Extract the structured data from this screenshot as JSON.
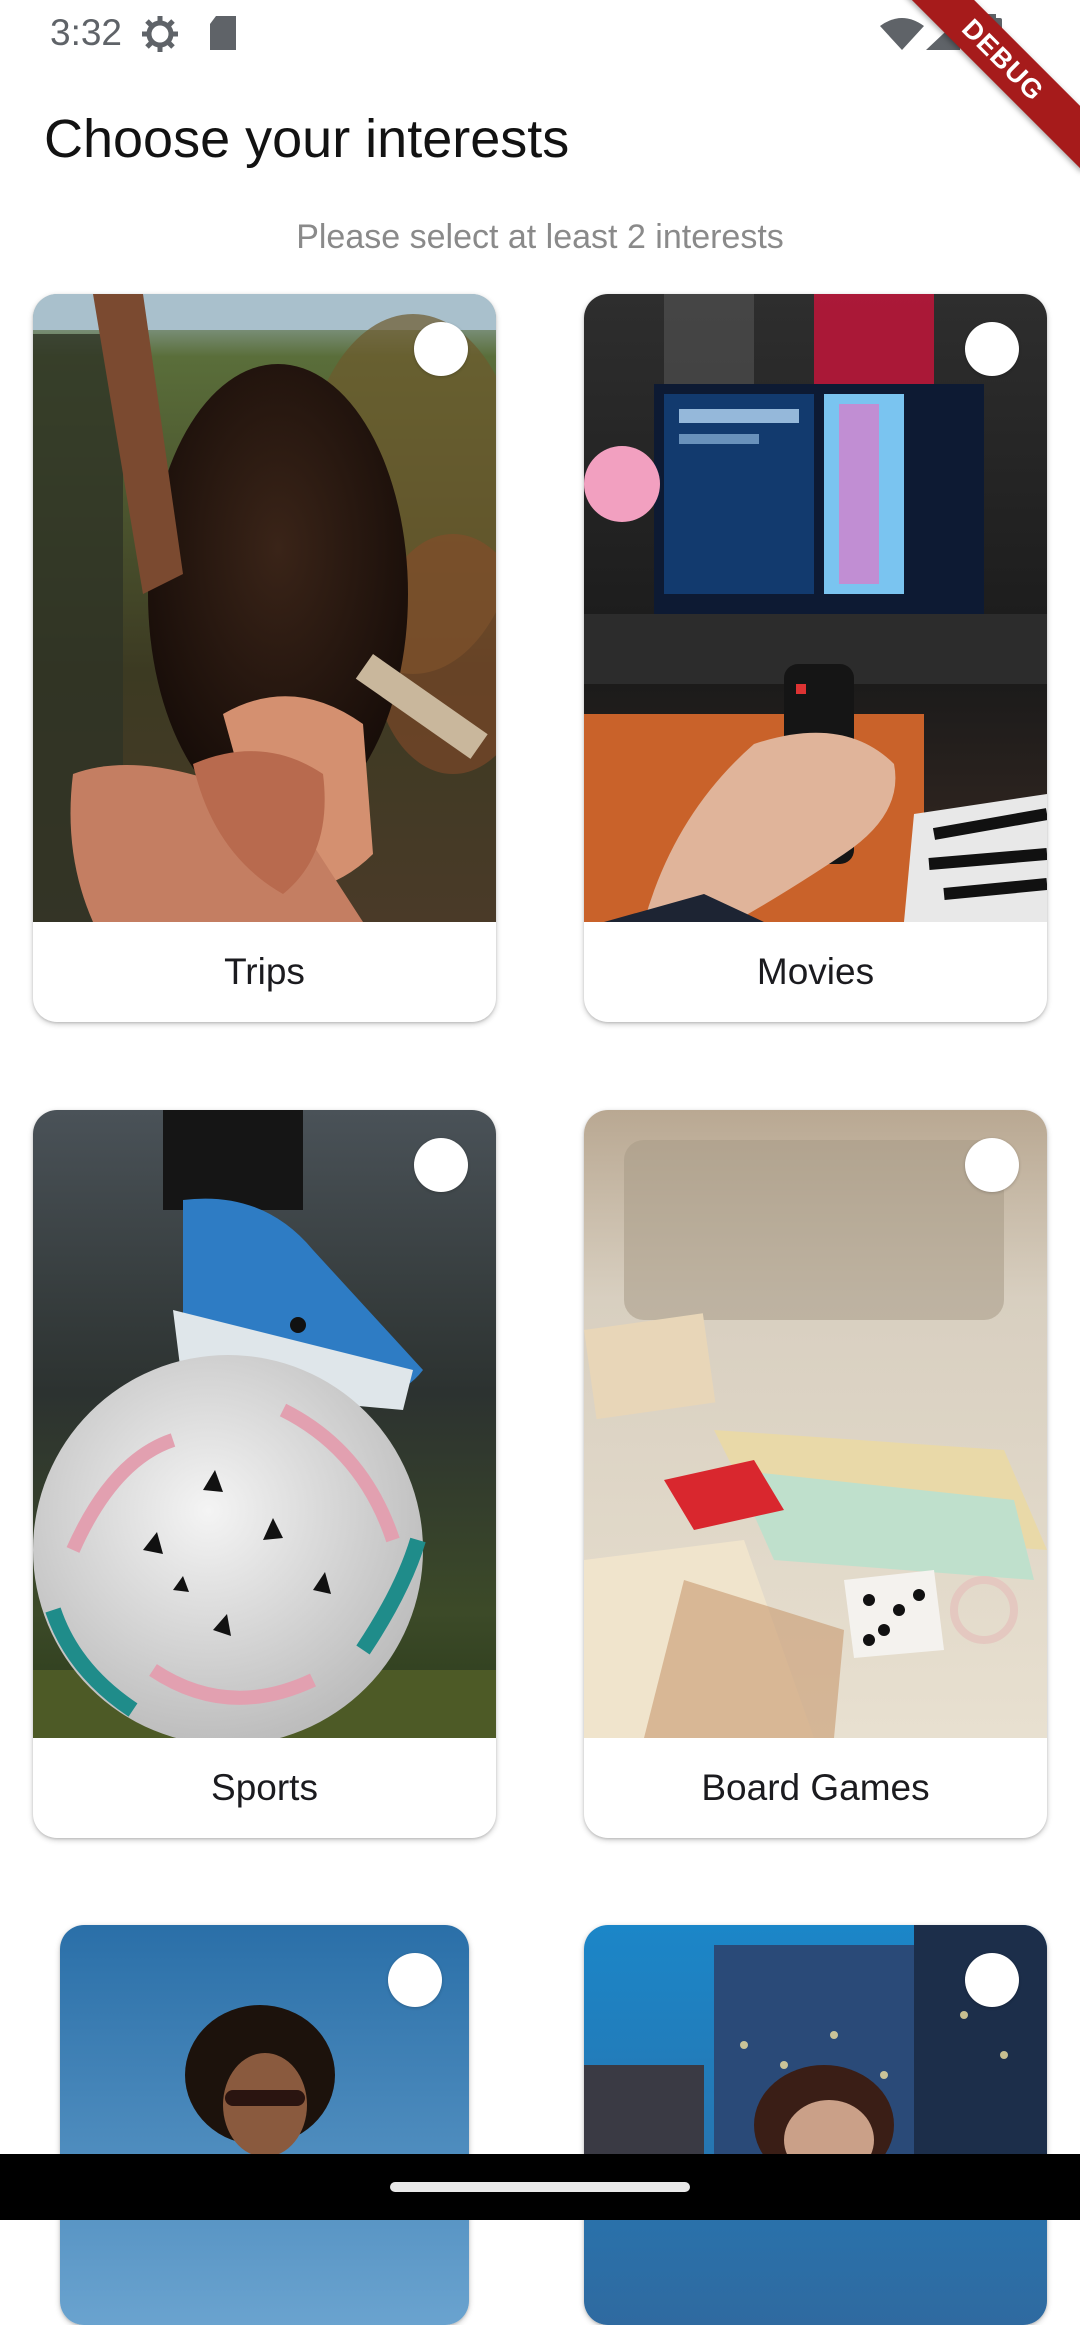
{
  "status_bar": {
    "time": "3:32",
    "icons": [
      "settings-icon",
      "sd-card-icon",
      "wifi-icon",
      "cellular-signal-icon",
      "battery-icon"
    ],
    "debug_banner": "DEBUG",
    "debug_color": "#a61b1b"
  },
  "header": {
    "title": "Choose your interests",
    "subtitle": "Please select at least 2 interests"
  },
  "interests": [
    {
      "label": "Trips",
      "image": "hands-holding-outdoors-photo",
      "selected": false
    },
    {
      "label": "Movies",
      "image": "tv-remote-photo",
      "selected": false
    },
    {
      "label": "Sports",
      "image": "soccer-ball-cleat-photo",
      "selected": false
    },
    {
      "label": "Board Games",
      "image": "monopoly-board-dice-photo",
      "selected": false
    },
    {
      "label": "",
      "image": "woman-sunglasses-blue-sky-photo",
      "selected": false
    },
    {
      "label": "",
      "image": "woman-camera-city-photo",
      "selected": false
    }
  ],
  "colors": {
    "background": "#ffffff",
    "title_text": "#121212",
    "subtitle_text": "#8a8a8a",
    "navigation_bar": "#000000"
  }
}
